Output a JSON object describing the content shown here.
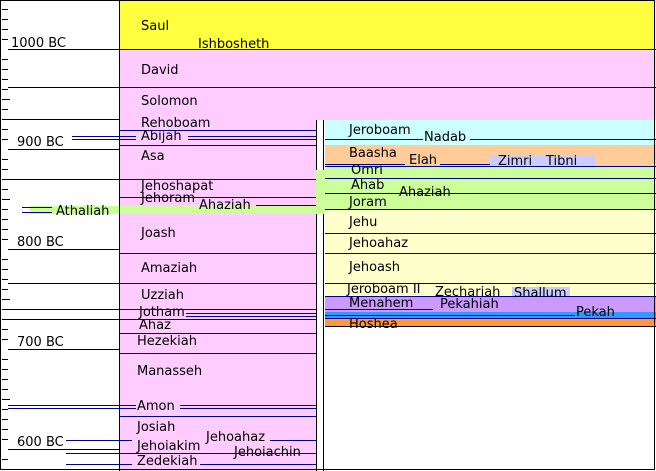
{
  "years": [
    "1000 BC",
    "900 BC",
    "800 BC",
    "700 BC",
    "600 BC"
  ],
  "united": [
    "Saul",
    "Ishbosheth",
    "David",
    "Solomon"
  ],
  "judah": [
    "Rehoboam",
    "Abijah",
    "Asa",
    "Jehoshapat",
    "Jehoram",
    "Ahaziah",
    "Athaliah",
    "Joash",
    "Amaziah",
    "Uzziah",
    "Jotham",
    "Ahaz",
    "Hezekiah",
    "Manasseh",
    "Amon",
    "Josiah",
    "Jehoahaz",
    "Jehoiakim",
    "Jehoiachin",
    "Zedekiah"
  ],
  "israel": [
    "Jeroboam",
    "Nadab",
    "Baasha",
    "Elah",
    "Zimri",
    "Tibni",
    "Omri",
    "Ahab",
    "Ahaziah",
    "Joram",
    "Jehu",
    "Jehoahaz",
    "Jehoash",
    "Jeroboam II",
    "Zechariah",
    "Shallum",
    "Menahem",
    "Pekahiah",
    "Pekah",
    "Hoshea"
  ],
  "colors": {
    "united_kingdom": "#ffff3f",
    "judah": "#ffccff",
    "jeroboam_dynasty": "#ccffff",
    "baasha_dynasty": "#ffcc99",
    "omri_dynasty": "#ccff99",
    "jehu_dynasty": "#ffffcc",
    "menahem_dynasty": "#cc99ff",
    "pekah": "#3399ff",
    "hoshea": "#ff9933",
    "athaliah": "#ccff99"
  }
}
